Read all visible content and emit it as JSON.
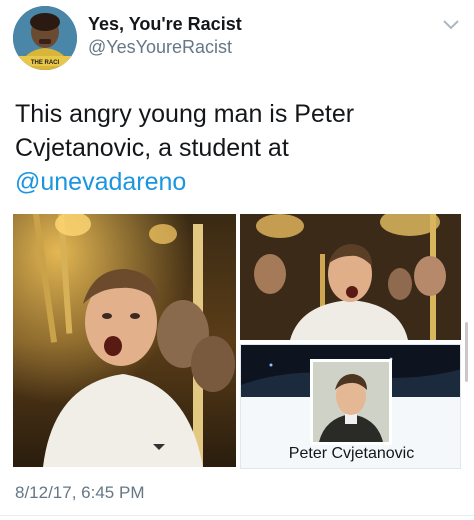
{
  "header": {
    "display_name": "Yes, You're Racist",
    "handle": "@YesYoureRacist",
    "avatar_icon": "profile-avatar-icon",
    "avatar_text": "THE RACI",
    "menu_icon": "chevron-down-icon"
  },
  "tweet": {
    "text_plain": "This angry young man is Peter Cvjetanovic, a student at ",
    "mention": "@unevadareno"
  },
  "media": {
    "photos": [
      {
        "name": "photo-torch-rally-shouting",
        "icon": "photo-icon"
      },
      {
        "name": "photo-torch-rally-crowd",
        "icon": "photo-icon"
      },
      {
        "name": "photo-profile-card",
        "icon": "photo-icon"
      }
    ],
    "profile_card_name": "Peter Cvjetanovic"
  },
  "footer": {
    "timestamp": "8/12/17, 6:45 PM"
  },
  "colors": {
    "link": "#1b95e0",
    "secondary_text": "#657786",
    "primary_text": "#14171a"
  }
}
